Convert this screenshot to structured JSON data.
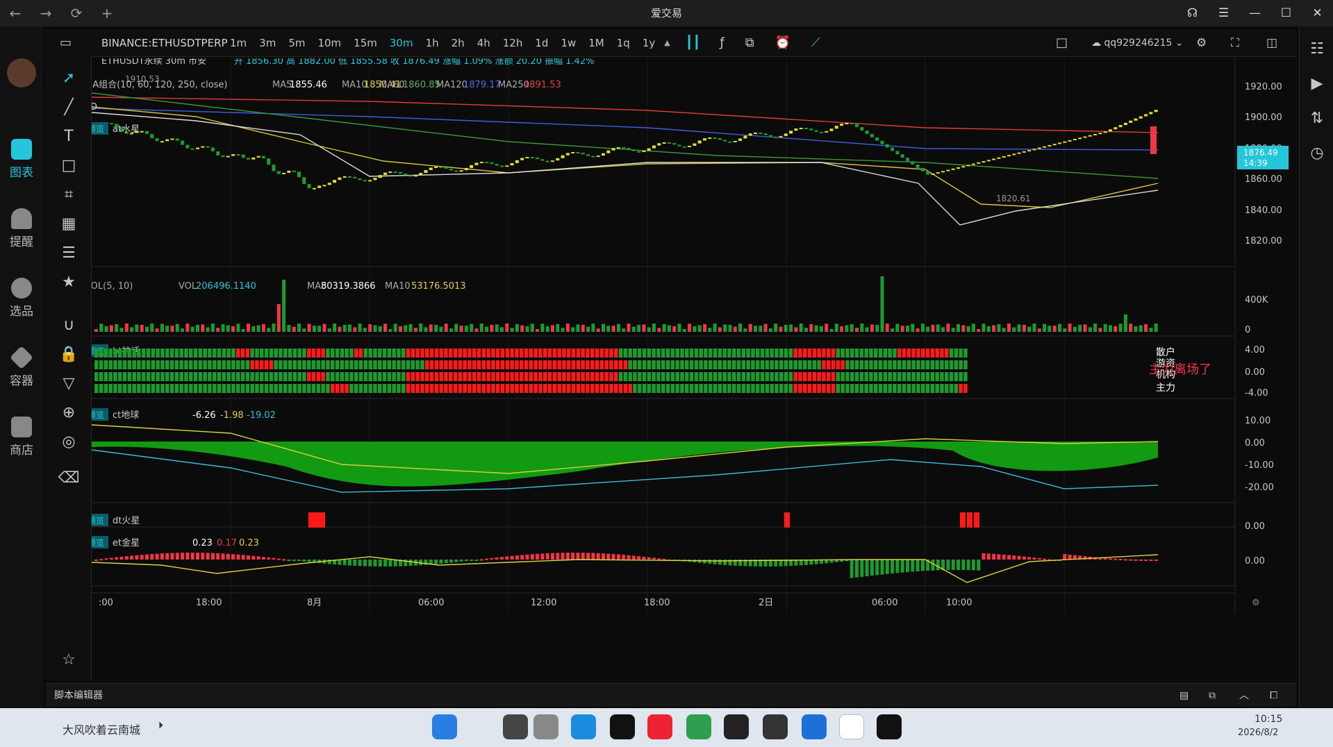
{
  "window": {
    "title": "爱交易",
    "nav": [
      "←",
      "→",
      "⟳",
      "+"
    ]
  },
  "leftbar": [
    {
      "label": "图表",
      "icon": "chart-icon",
      "active": true
    },
    {
      "label": "提醒",
      "icon": "bell-icon"
    },
    {
      "label": "选品",
      "icon": "screener-icon"
    },
    {
      "label": "容器",
      "icon": "container-icon"
    },
    {
      "label": "商店",
      "icon": "store-icon"
    }
  ],
  "toolbar": {
    "symbol": "BINANCE:ETHUSDTPERP",
    "intervals": [
      "1m",
      "3m",
      "5m",
      "10m",
      "15m",
      "30m",
      "1h",
      "2h",
      "4h",
      "12h",
      "1d",
      "1w",
      "1M",
      "1q",
      "1y"
    ],
    "active_interval": "30m",
    "user": "qq929246215"
  },
  "legend": {
    "main": {
      "name": "ETHUSDT永续 30m 币安",
      "open_label": "开",
      "open": "1856.30",
      "high_label": "高",
      "high": "1882.00",
      "low_label": "低",
      "low": "1855.58",
      "close_label": "收",
      "close": "1876.49",
      "chg_pct_label": "涨幅",
      "chg_pct": "1.09%",
      "chg_label": "涨额",
      "chg": "20.20",
      "amp_label": "振幅",
      "amp": "1.42%"
    },
    "ma": {
      "name": "MA组合",
      "params": "(10, 60, 120, 250, close)",
      "ma5_label": "MA5",
      "ma5": "1855.46",
      "ma10_label": "MA10",
      "ma10": "1850.41",
      "ma60_label": "MA60",
      "ma60": "1860.85",
      "ma120_label": "MA120",
      "ma120": "1879.17",
      "ma250_label": "MA250",
      "ma250": "1891.53"
    },
    "td": {
      "name": "TD"
    },
    "at": {
      "tag": "预览",
      "name": "at水星"
    },
    "vol": {
      "name": "VOL",
      "params": "(5, 10)",
      "vol_label": "VOL",
      "vol": "206496.1140",
      "ma5_label": "MA5",
      "ma5": "80319.3866",
      "ma10_label": "MA10",
      "ma10": "53176.5013"
    },
    "bt": {
      "tag": "预览",
      "name": "bt神话",
      "labels": [
        "散户",
        "游资",
        "机构",
        "主力"
      ],
      "banner": "主力离场了"
    },
    "ct": {
      "tag": "预览",
      "name": "ct地球",
      "v1": "-6.26",
      "v2": "-1.98",
      "v3": "-19.02"
    },
    "dt": {
      "tag": "预览",
      "name": "dt火星"
    },
    "et": {
      "tag": "预览",
      "name": "et金星",
      "v1": "0.23",
      "v2": "0.17",
      "v3": "0.23"
    }
  },
  "price_axis": [
    "1920.00",
    "1900.00",
    "1880.00",
    "1860.00",
    "1840.00",
    "1820.00"
  ],
  "last_price": {
    "price": "1876.49",
    "countdown": "14:39"
  },
  "annotations": {
    "high": "1910.53",
    "low": "1820.61"
  },
  "vol_axis": [
    "400K",
    "0"
  ],
  "bt_axis": [
    "4.00",
    "0.00",
    "-4.00"
  ],
  "ct_axis": [
    "10.00",
    "0.00",
    "-10.00",
    "-20.00"
  ],
  "dt_axis": [
    "0.00"
  ],
  "et_axis": [
    "0.00"
  ],
  "time_axis": [
    ":00",
    "18:00",
    "8月",
    "06:00",
    "12:00",
    "18:00",
    "2日",
    "06:00",
    "10:00"
  ],
  "script_editor": "脚本编辑器",
  "taskbar": {
    "left_text": "大风吹着云南城",
    "time": "10:15",
    "date": "2026/8/2"
  },
  "colors": {
    "up": "#f23645",
    "down": "#1e9b2e",
    "accent": "#26c6da",
    "bg": "#0b0b0b"
  }
}
